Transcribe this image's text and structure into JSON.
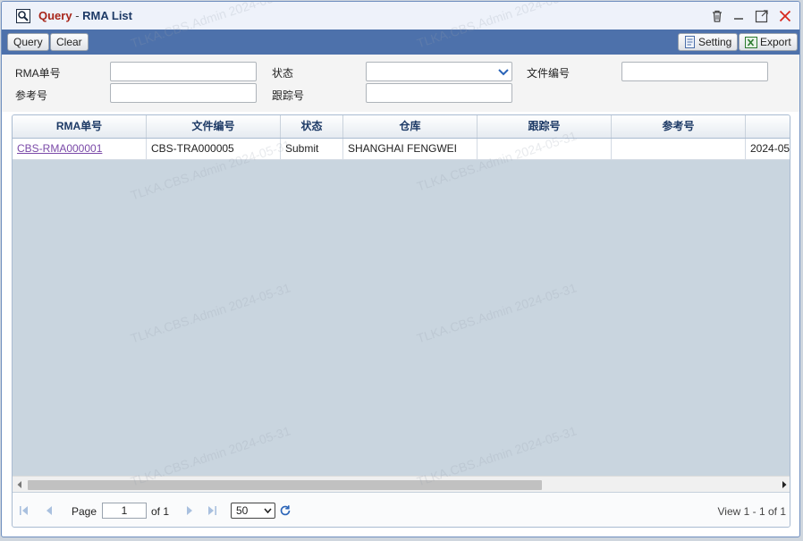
{
  "window": {
    "title_query": "Query",
    "title_sep": " - ",
    "title_name": "RMA List"
  },
  "toolbar": {
    "query_label": "Query",
    "clear_label": "Clear",
    "setting_label": "Setting",
    "export_label": "Export"
  },
  "form": {
    "rma_no_label": "RMA单号",
    "ref_no_label": "参考号",
    "status_label": "状态",
    "tracking_no_label": "跟踪号",
    "file_no_label": "文件编号"
  },
  "grid": {
    "columns": [
      "RMA单号",
      "文件编号",
      "状态",
      "仓库",
      "跟踪号",
      "参考号"
    ],
    "rows": [
      {
        "rma_no": "CBS-RMA000001",
        "file_no": "CBS-TRA000005",
        "status": "Submit",
        "warehouse": "SHANGHAI FENGWEI",
        "tracking_no": "",
        "ref_no": "",
        "date": "2024-05"
      }
    ]
  },
  "pager": {
    "page_label": "Page",
    "page_value": "1",
    "of_label": "of 1",
    "page_size": "50",
    "view_text": "View 1 - 1 of 1"
  },
  "watermark": "TLKA.CBS.Admin 2024-05-31"
}
